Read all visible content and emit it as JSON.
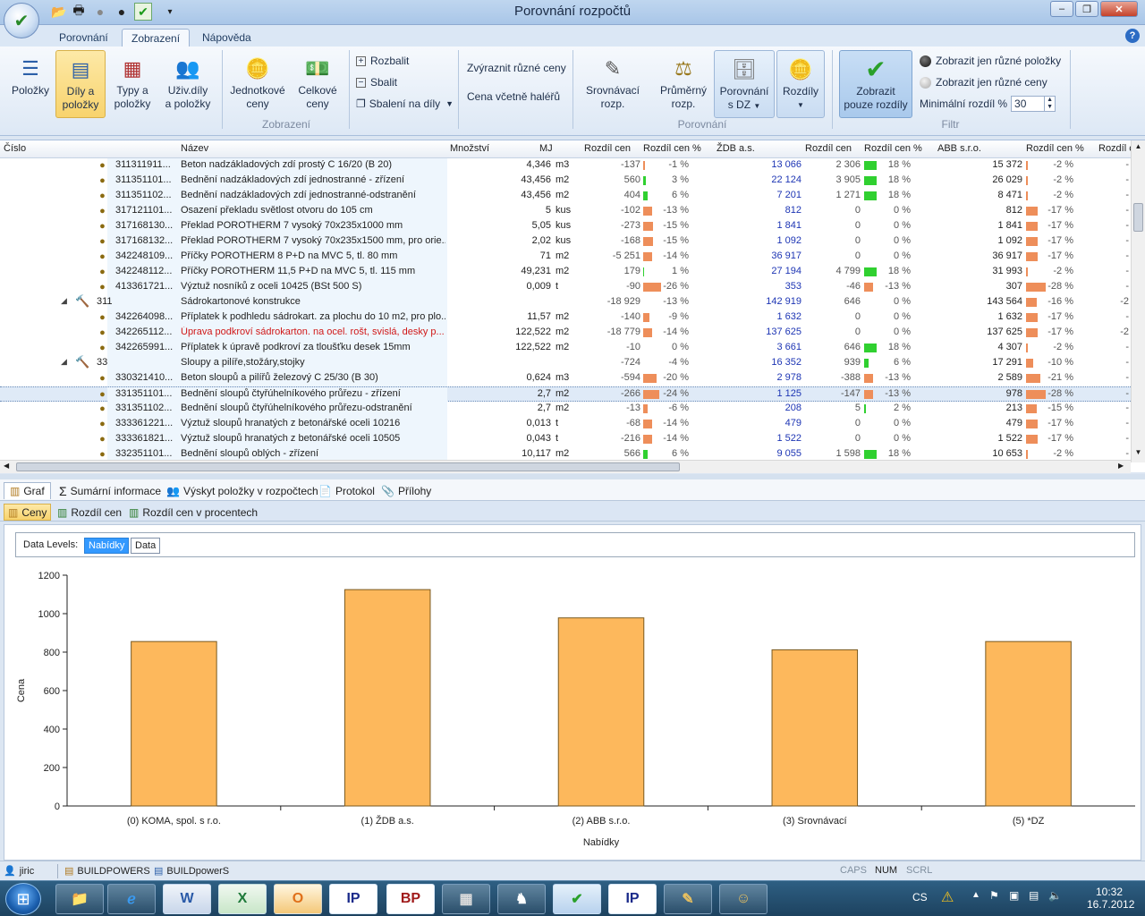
{
  "window": {
    "title": "Porovnání rozpočtů"
  },
  "tabs": [
    "Porovnání",
    "Zobrazení",
    "Nápověda"
  ],
  "ribbon": {
    "group_zobrazeni": {
      "label": "Zobrazení",
      "polozky": "Položky",
      "dily_a": "Díly a",
      "dily_b": "položky",
      "typy_a": "Typy a",
      "typy_b": "položky",
      "uziv_a": "Uživ.díly",
      "uziv_b": "a položky",
      "jedn_a": "Jednotkové",
      "jedn_b": "ceny",
      "celk_a": "Celkové",
      "celk_b": "ceny",
      "rozbalit": "Rozbalit",
      "sbalit": "Sbalit",
      "sbaleni": "Sbalení na díly",
      "zvyraznit": "Zvýraznit různé ceny",
      "cena_halere": "Cena včetně haléřů"
    },
    "group_porovnani": {
      "label": "Porovnání",
      "srovn_a": "Srovnávací",
      "srovn_b": "rozp.",
      "prum_a": "Průměrný",
      "prum_b": "rozp.",
      "pordz_a": "Porovnání",
      "pordz_b": "s DZ",
      "rozdily": "Rozdíly"
    },
    "group_filtr": {
      "label": "Filtr",
      "apply_a": "Zobrazit",
      "apply_b": "pouze rozdíly",
      "radio1": "Zobrazit jen různé položky",
      "radio2": "Zobrazit jen různé ceny",
      "min_label": "Minimální rozdíl %",
      "min_value": "30"
    }
  },
  "grid": {
    "columns": {
      "cislo": "Číslo",
      "nazev": "Název",
      "mnozstvi": "Množství",
      "mj": "MJ",
      "rc1": "Rozdíl cen",
      "rcp1": "Rozdíl cen %",
      "zdb": "ŽDB a.s.",
      "rc2": "Rozdíl cen",
      "rcp2": "Rozdíl cen %",
      "abb": "ABB s.r.o.",
      "rcp3": "Rozdíl cen %",
      "rc4": "Rozdíl c"
    },
    "rows": [
      {
        "type": "item",
        "code": "311311911...",
        "name": "Beton nadzákladových zdí prostý C 16/20  (B 20)",
        "qty": "4,346",
        "mj": "m3",
        "d1": "-137",
        "p1": "-1 %",
        "zdb": "13 066",
        "d2": "2 306",
        "p2": "18 %",
        "abb": "15 372",
        "p3": "-2 %",
        "b1c": "o",
        "b1w": 2,
        "b2c": "g",
        "b2w": 14,
        "b3c": "o",
        "b3w": 2
      },
      {
        "type": "item",
        "code": "311351101...",
        "name": "Bednění nadzákladových zdí jednostranné - zřízení",
        "qty": "43,456",
        "mj": "m2",
        "d1": "560",
        "p1": "3 %",
        "zdb": "22 124",
        "d2": "3 905",
        "p2": "18 %",
        "abb": "26 029",
        "p3": "-2 %",
        "b1c": "g",
        "b1w": 3,
        "b2c": "g",
        "b2w": 14,
        "b3c": "o",
        "b3w": 2
      },
      {
        "type": "item",
        "code": "311351102...",
        "name": "Bednění nadzákladových zdí jednostranné-odstranění",
        "qty": "43,456",
        "mj": "m2",
        "d1": "404",
        "p1": "6 %",
        "zdb": "7 201",
        "d2": "1 271",
        "p2": "18 %",
        "abb": "8 471",
        "p3": "-2 %",
        "b1c": "g",
        "b1w": 5,
        "b2c": "g",
        "b2w": 14,
        "b3c": "o",
        "b3w": 2
      },
      {
        "type": "item",
        "code": "317121101...",
        "name": "Osazení překladu světlost otvoru do 105 cm",
        "qty": "5",
        "mj": "kus",
        "d1": "-102",
        "p1": "-13 %",
        "zdb": "812",
        "d2": "0",
        "p2": "0 %",
        "abb": "812",
        "p3": "-17 %",
        "b1c": "o",
        "b1w": 10,
        "b2c": "",
        "b2w": 0,
        "b3c": "o",
        "b3w": 13
      },
      {
        "type": "item",
        "code": "317168130...",
        "name": "Překlad POROTHERM 7 vysoký 70x235x1000 mm",
        "qty": "5,05",
        "mj": "kus",
        "d1": "-273",
        "p1": "-15 %",
        "zdb": "1 841",
        "d2": "0",
        "p2": "0 %",
        "abb": "1 841",
        "p3": "-17 %",
        "b1c": "o",
        "b1w": 11,
        "b2c": "",
        "b2w": 0,
        "b3c": "o",
        "b3w": 13
      },
      {
        "type": "item",
        "code": "317168132...",
        "name": "Překlad POROTHERM 7 vysoký 70x235x1500 mm, pro orie...",
        "qty": "2,02",
        "mj": "kus",
        "d1": "-168",
        "p1": "-15 %",
        "zdb": "1 092",
        "d2": "0",
        "p2": "0 %",
        "abb": "1 092",
        "p3": "-17 %",
        "b1c": "o",
        "b1w": 11,
        "b2c": "",
        "b2w": 0,
        "b3c": "o",
        "b3w": 13
      },
      {
        "type": "item",
        "code": "342248109...",
        "name": "Příčky POROTHERM 8 P+D na MVC 5, tl. 80 mm",
        "qty": "71",
        "mj": "m2",
        "d1": "-5 251",
        "p1": "-14 %",
        "zdb": "36 917",
        "d2": "0",
        "p2": "0 %",
        "abb": "36 917",
        "p3": "-17 %",
        "b1c": "o",
        "b1w": 10,
        "b2c": "",
        "b2w": 0,
        "b3c": "o",
        "b3w": 13
      },
      {
        "type": "item",
        "code": "342248112...",
        "name": "Příčky POROTHERM 11,5 P+D na MVC 5, tl. 115 mm",
        "qty": "49,231",
        "mj": "m2",
        "d1": "179",
        "p1": "1 %",
        "zdb": "27 194",
        "d2": "4 799",
        "p2": "18 %",
        "abb": "31 993",
        "p3": "-2 %",
        "b1c": "g",
        "b1w": 1,
        "b2c": "g",
        "b2w": 14,
        "b3c": "o",
        "b3w": 2
      },
      {
        "type": "item",
        "code": "413361721...",
        "name": "Výztuž nosníků z oceli 10425 (BSt 500 S)",
        "qty": "0,009",
        "mj": "t",
        "d1": "-90",
        "p1": "-26 %",
        "zdb": "353",
        "d2": "-46",
        "p2": "-13 %",
        "abb": "307",
        "p3": "-28 %",
        "b1c": "o",
        "b1w": 20,
        "b2c": "o",
        "b2w": 10,
        "b3c": "o",
        "b3w": 22
      },
      {
        "type": "group",
        "code": "311",
        "name": "Sádrokartonové konstrukce",
        "qty": "",
        "mj": "",
        "d1": "-18 929",
        "p1": "-13 %",
        "zdb": "142 919",
        "d2": "646",
        "p2": "0 %",
        "abb": "143 564",
        "p3": "-16 %",
        "extra": "-2",
        "b1c": "",
        "b1w": 0,
        "b2c": "",
        "b2w": 0,
        "b3c": "o",
        "b3w": 12
      },
      {
        "type": "item",
        "code": "342264098...",
        "name": "Příplatek k podhledu sádrokart. za plochu do 10 m2, pro plo...",
        "qty": "11,57",
        "mj": "m2",
        "d1": "-140",
        "p1": "-9 %",
        "zdb": "1 632",
        "d2": "0",
        "p2": "0 %",
        "abb": "1 632",
        "p3": "-17 %",
        "b1c": "o",
        "b1w": 7,
        "b2c": "",
        "b2w": 0,
        "b3c": "o",
        "b3w": 13
      },
      {
        "type": "item",
        "red": true,
        "code": "342265112...",
        "name": "Úprava podkroví sádrokarton. na ocel. rošt, svislá, desky p...",
        "qty": "122,522",
        "mj": "m2",
        "d1": "-18 779",
        "p1": "-14 %",
        "zdb": "137 625",
        "d2": "0",
        "p2": "0 %",
        "abb": "137 625",
        "p3": "-17 %",
        "extra": "-2",
        "b1c": "o",
        "b1w": 10,
        "b2c": "",
        "b2w": 0,
        "b3c": "o",
        "b3w": 13
      },
      {
        "type": "item",
        "code": "342265991...",
        "name": "Příplatek k úpravě podkroví za tloušťku desek 15mm",
        "qty": "122,522",
        "mj": "m2",
        "d1": "-10",
        "p1": "0 %",
        "zdb": "3 661",
        "d2": "646",
        "p2": "18 %",
        "abb": "4 307",
        "p3": "-2 %",
        "b1c": "",
        "b1w": 0,
        "b2c": "g",
        "b2w": 14,
        "b3c": "o",
        "b3w": 2
      },
      {
        "type": "group",
        "code": "33",
        "name": "Sloupy a pilíře,stožáry,stojky",
        "qty": "",
        "mj": "",
        "d1": "-724",
        "p1": "-4 %",
        "zdb": "16 352",
        "d2": "939",
        "p2": "6 %",
        "abb": "17 291",
        "p3": "-10 %",
        "b1c": "",
        "b1w": 0,
        "b2c": "g",
        "b2w": 5,
        "b3c": "o",
        "b3w": 8
      },
      {
        "type": "item",
        "code": "330321410...",
        "name": "Beton sloupů a pilířů železový C 25/30  (B 30)",
        "qty": "0,624",
        "mj": "m3",
        "d1": "-594",
        "p1": "-20 %",
        "zdb": "2 978",
        "d2": "-388",
        "p2": "-13 %",
        "abb": "2 589",
        "p3": "-21 %",
        "b1c": "o",
        "b1w": 15,
        "b2c": "o",
        "b2w": 10,
        "b3c": "o",
        "b3w": 16
      },
      {
        "type": "item",
        "selected": true,
        "code": "331351101...",
        "name": "Bednění sloupů čtyřúhelníkového průřezu - zřízení",
        "qty": "2,7",
        "mj": "m2",
        "d1": "-266",
        "p1": "-24 %",
        "zdb": "1 125",
        "d2": "-147",
        "p2": "-13 %",
        "abb": "978",
        "p3": "-28 %",
        "b1c": "o",
        "b1w": 18,
        "b2c": "o",
        "b2w": 10,
        "b3c": "o",
        "b3w": 22
      },
      {
        "type": "item",
        "code": "331351102...",
        "name": "Bednění sloupů čtyřúhelníkového průřezu-odstranění",
        "qty": "2,7",
        "mj": "m2",
        "d1": "-13",
        "p1": "-6 %",
        "zdb": "208",
        "d2": "5",
        "p2": "2 %",
        "abb": "213",
        "p3": "-15 %",
        "b1c": "o",
        "b1w": 5,
        "b2c": "g",
        "b2w": 2,
        "b3c": "o",
        "b3w": 12
      },
      {
        "type": "item",
        "code": "333361221...",
        "name": "Výztuž sloupů hranatých z betonářské oceli 10216",
        "qty": "0,013",
        "mj": "t",
        "d1": "-68",
        "p1": "-14 %",
        "zdb": "479",
        "d2": "0",
        "p2": "0 %",
        "abb": "479",
        "p3": "-17 %",
        "b1c": "o",
        "b1w": 10,
        "b2c": "",
        "b2w": 0,
        "b3c": "o",
        "b3w": 13
      },
      {
        "type": "item",
        "code": "333361821...",
        "name": "Výztuž sloupů hranatých z betonářské oceli 10505",
        "qty": "0,043",
        "mj": "t",
        "d1": "-216",
        "p1": "-14 %",
        "zdb": "1 522",
        "d2": "0",
        "p2": "0 %",
        "abb": "1 522",
        "p3": "-17 %",
        "b1c": "o",
        "b1w": 10,
        "b2c": "",
        "b2w": 0,
        "b3c": "o",
        "b3w": 13
      },
      {
        "type": "item",
        "code": "332351101...",
        "name": "Bednění sloupů oblých - zřízení",
        "qty": "10,117",
        "mj": "m2",
        "d1": "566",
        "p1": "6 %",
        "zdb": "9 055",
        "d2": "1 598",
        "p2": "18 %",
        "abb": "10 653",
        "p3": "-2 %",
        "b1c": "g",
        "b1w": 5,
        "b2c": "g",
        "b2w": 14,
        "b3c": "o",
        "b3w": 2
      }
    ]
  },
  "bottom_tabs": [
    "Graf",
    "Sumární informace",
    "Výskyt položky v rozpočtech",
    "Protokol",
    "Přílohy"
  ],
  "chart_tabs": [
    "Ceny",
    "Rozdíl cen",
    "Rozdíl cen v procentech"
  ],
  "levels": {
    "label": "Data Levels:",
    "level1": "Nabídky",
    "level2": "Data"
  },
  "chart_data": {
    "type": "bar",
    "categories": [
      "(0) KOMA, spol. s r.o.",
      "(1) ŽDB a.s.",
      "(2) ABB s.r.o.",
      "(3) Srovnávací",
      "(5) *DZ"
    ],
    "values": [
      855,
      1125,
      978,
      812,
      855
    ],
    "xlabel": "Nabídky",
    "ylabel": "Cena",
    "ylim": [
      0,
      1200
    ],
    "yticks": [
      0,
      200,
      400,
      600,
      800,
      1000,
      1200
    ],
    "bar_color": "#fdb85c",
    "grid": false
  },
  "status": {
    "user": "jiric",
    "db1": "BUILDPOWERS",
    "db2": "BUILDpowerS",
    "caps": "CAPS",
    "num": "NUM",
    "scrl": "SCRL"
  },
  "taskbar": {
    "lang": "CS",
    "time": "10:32",
    "date": "16.7.2012"
  },
  "colors": {
    "accent_selected": "#f8d36d",
    "negative_bar": "#ee8e5a",
    "positive_bar": "#30d030",
    "link_blue": "#1d35b4",
    "error_red": "#d01818"
  }
}
